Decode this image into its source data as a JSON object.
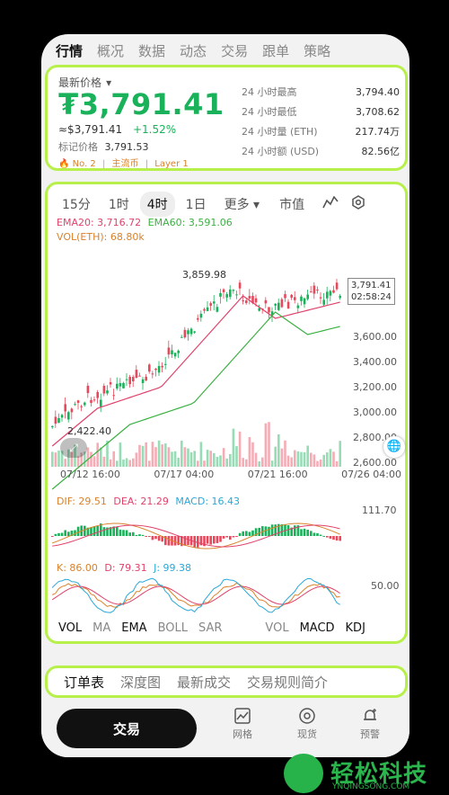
{
  "tabs": [
    "行情",
    "概况",
    "数据",
    "动态",
    "交易",
    "跟单",
    "策略"
  ],
  "ticker": {
    "label": "最新价格",
    "price": "₮3,791.41",
    "approx": "≈$3,791.41",
    "change": "+1.52%",
    "mark_label": "标记价格",
    "mark_value": "3,791.53",
    "rank": "No. 2",
    "tag1": "主流币",
    "tag2": "Layer 1"
  },
  "stats": [
    {
      "label": "24 小时最高",
      "value": "3,794.40"
    },
    {
      "label": "24 小时最低",
      "value": "3,708.62"
    },
    {
      "label": "24 小时量 (ETH)",
      "value": "217.74万"
    },
    {
      "label": "24 小时额 (USD)",
      "value": "82.56亿"
    }
  ],
  "periods": [
    "15分",
    "1时",
    "4时",
    "1日",
    "更多"
  ],
  "period_selected": "4时",
  "chart_toggle": "市值",
  "ema": {
    "ema20": "EMA20: 3,716.72",
    "ema60": "EMA60: 3,591.06"
  },
  "vol_label": "VOL(ETH): 68.80k",
  "price_labels": [
    "3,600.00",
    "3,400.00",
    "3,200.00",
    "3,000.00",
    "2,800.00",
    "2,600.00"
  ],
  "high_marker": "3,859.98",
  "low_marker": "2,422.40",
  "current_price_box": {
    "price": "3,791.41",
    "countdown": "02:58:24"
  },
  "dates": [
    "07/12 16:00",
    "07/17 04:00",
    "07/21 16:00",
    "07/26 04:00"
  ],
  "macd_label": {
    "dif": "DIF: 29.51",
    "dea": "DEA: 21.29",
    "macd": "MACD: 16.43"
  },
  "macd_axis": "111.70",
  "kdj_label": {
    "k": "K: 86.00",
    "d": "D: 79.31",
    "j": "J: 99.38"
  },
  "kdj_axis": "50.00",
  "indicators": [
    "VOL",
    "MA",
    "EMA",
    "BOLL",
    "SAR",
    "VOL",
    "MACD",
    "KDJ"
  ],
  "subtabs": [
    "订单表",
    "深度图",
    "最新成交",
    "交易规则简介"
  ],
  "bottom": {
    "trade": "交易",
    "grid": "网格",
    "spot": "现货",
    "alert": "预警"
  },
  "watermark": {
    "title": "轻松科技",
    "url": "YNQINGSONG.COM"
  },
  "colors": {
    "up": "#19b25a",
    "down": "#e8485b",
    "accent": "#b7f04a"
  },
  "chart_data": {
    "type": "candlestick",
    "x": [
      "07/12 16:00",
      "07/17 04:00",
      "07/21 16:00",
      "07/26 04:00"
    ],
    "ylim": [
      2422.4,
      3859.98
    ],
    "series": [
      {
        "name": "EMA20",
        "values": [
          3716.72
        ]
      },
      {
        "name": "EMA60",
        "values": [
          3591.06
        ]
      }
    ]
  }
}
